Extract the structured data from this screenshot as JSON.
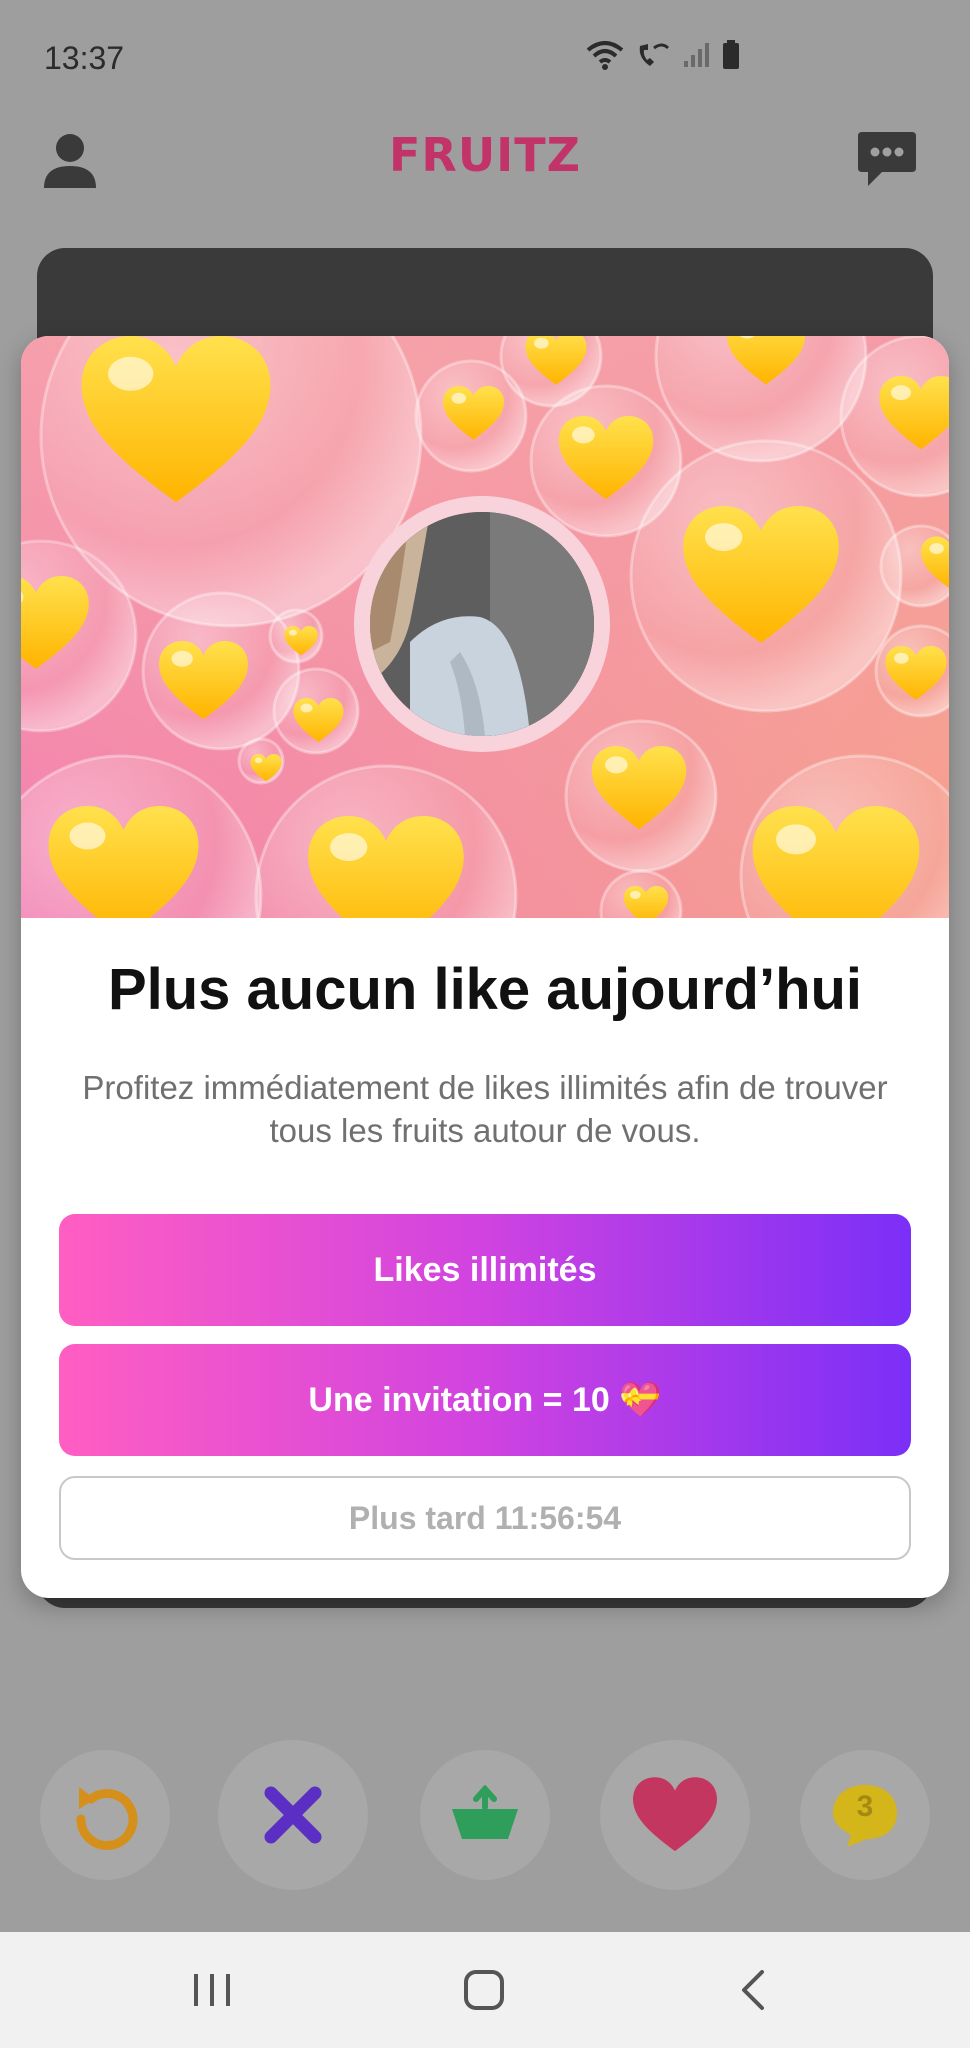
{
  "status": {
    "time": "13:37"
  },
  "app": {
    "brand": "FRUITZ"
  },
  "modal": {
    "title": "Plus aucun like aujourd’hui",
    "subtitle": "Profitez immédiatement de likes illimités afin de trouver tous les fruits autour de vous.",
    "buttons": {
      "likes": "Likes illimités",
      "invite": "Une invitation = 10 💝",
      "later": "Plus tard 11:56:54"
    }
  },
  "actions": {
    "chat_badge": "3"
  },
  "colors": {
    "brand": "#c2336a",
    "gradient_start": "#ff5ec2",
    "gradient_end": "#7b2ff7",
    "undo": "#d4901a",
    "pass": "#5b2fc4",
    "basket": "#2e9e5a",
    "like": "#c23660",
    "chat": "#d4b51a"
  }
}
